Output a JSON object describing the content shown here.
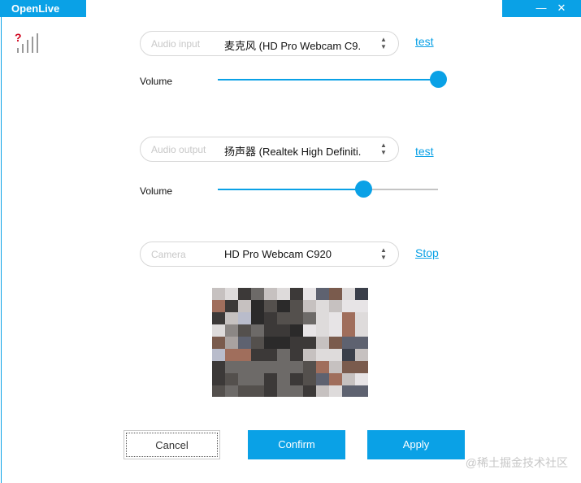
{
  "app": {
    "title": "OpenLive"
  },
  "window_controls": {
    "minimize": "—",
    "close": "✕"
  },
  "audio_input": {
    "placeholder": "Audio input",
    "value": "麦克风 (HD Pro Webcam C9...",
    "action": "test",
    "volume_label": "Volume",
    "volume_level": 1.0
  },
  "audio_output": {
    "placeholder": "Audio output",
    "value": "扬声器 (Realtek High Definiti...",
    "action": "test",
    "volume_label": "Volume",
    "volume_level": 0.66
  },
  "camera": {
    "placeholder": "Camera",
    "value": "HD Pro Webcam C920",
    "action": "Stop"
  },
  "buttons": {
    "cancel": "Cancel",
    "confirm": "Confirm",
    "apply": "Apply"
  },
  "watermark": "@稀土掘金技术社区",
  "colors": {
    "accent": "#0aa1e6"
  }
}
